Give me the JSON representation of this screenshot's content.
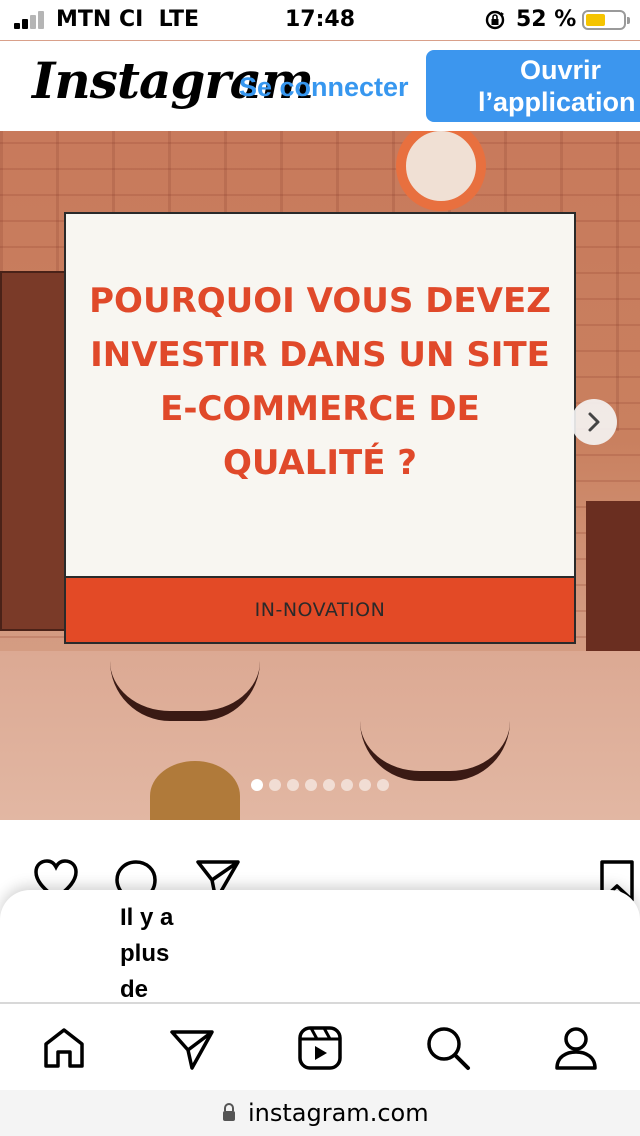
{
  "status_bar": {
    "carrier": "MTN CI",
    "network": "LTE",
    "time": "17:48",
    "battery_percent": "52 %",
    "battery_level": 0.52,
    "icons": [
      "signal-icon",
      "orientation-lock-icon",
      "battery-icon"
    ]
  },
  "header": {
    "logo": "Instagram",
    "login_label": "Se connecter",
    "open_app_line1": "Ouvrir",
    "open_app_line2": "l’application"
  },
  "post": {
    "card_title": "POURQUOI VOUS DEVEZ INVESTIR DANS UN SITE E-COMMERCE DE QUALITÉ ?",
    "card_footer": "IN-NOVATION",
    "carousel_count": 8,
    "carousel_active": 1
  },
  "actions": {
    "icons": [
      "heart-icon",
      "comment-icon",
      "share-icon",
      "bookmark-icon"
    ]
  },
  "sheet": {
    "text": "Il y a plus de"
  },
  "tabbar": {
    "icons": [
      "home-icon",
      "direct-icon",
      "reels-icon",
      "search-icon",
      "profile-icon"
    ]
  },
  "url_bar": {
    "url": "instagram.com"
  },
  "colors": {
    "accent_blue": "#3c96ee",
    "link_blue": "#3797ef",
    "card_red": "#e34a26",
    "title_red": "#e0492a"
  }
}
